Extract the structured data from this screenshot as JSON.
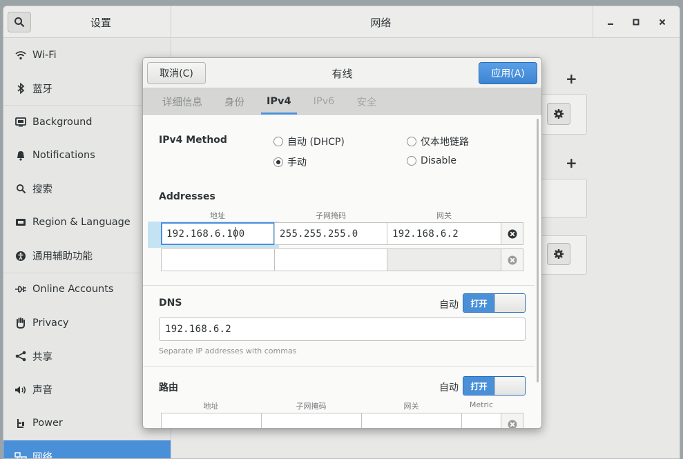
{
  "window": {
    "sidebar_title": "设置",
    "main_title": "网络",
    "controls": {
      "minimize": "–",
      "maximize": "□",
      "close": "×"
    }
  },
  "sidebar": {
    "items": [
      {
        "label": "Wi-Fi",
        "icon": "wifi-icon"
      },
      {
        "label": "蓝牙",
        "icon": "bluetooth-icon"
      },
      {
        "label": "Background",
        "icon": "background-icon"
      },
      {
        "label": "Notifications",
        "icon": "bell-icon"
      },
      {
        "label": "搜索",
        "icon": "search-icon"
      },
      {
        "label": "Region & Language",
        "icon": "region-icon"
      },
      {
        "label": "通用辅助功能",
        "icon": "accessibility-icon"
      },
      {
        "label": "Online Accounts",
        "icon": "online-accounts-icon"
      },
      {
        "label": "Privacy",
        "icon": "hand-icon"
      },
      {
        "label": "共享",
        "icon": "share-icon"
      },
      {
        "label": "声音",
        "icon": "speaker-icon"
      },
      {
        "label": "Power",
        "icon": "power-icon"
      },
      {
        "label": "网络",
        "icon": "network-icon"
      }
    ],
    "active_index": 12
  },
  "main": {
    "plus": "+"
  },
  "dialog": {
    "cancel_label": "取消(C)",
    "title": "有线",
    "apply_label": "应用(A)",
    "tabs": [
      {
        "label": "详细信息"
      },
      {
        "label": "身份"
      },
      {
        "label": "IPv4"
      },
      {
        "label": "IPv6"
      },
      {
        "label": "安全"
      }
    ],
    "active_tab": 2,
    "ipv4": {
      "method_label": "IPv4 Method",
      "options": {
        "auto_dhcp": "自动 (DHCP)",
        "link_local": "仅本地链路",
        "manual": "手动",
        "disable": "Disable"
      },
      "selected": "manual",
      "addresses_label": "Addresses",
      "address_columns": [
        "地址",
        "子网掩码",
        "网关"
      ],
      "address_rows": [
        {
          "address": "192.168.6.100",
          "netmask": "255.255.255.0",
          "gateway": "192.168.6.2"
        },
        {
          "address": "",
          "netmask": "",
          "gateway": ""
        }
      ],
      "dns_label": "DNS",
      "dns_auto_label": "自动",
      "dns_switch_label": "打开",
      "dns_value": "192.168.6.2",
      "dns_hint": "Separate IP addresses with commas",
      "routes_label": "路由",
      "routes_auto_label": "自动",
      "routes_switch_label": "打开",
      "route_columns": [
        "地址",
        "子网掩码",
        "网关",
        "Metric"
      ]
    }
  },
  "colors": {
    "accent": "#4a90d9",
    "selection": "#c3e2f2"
  }
}
